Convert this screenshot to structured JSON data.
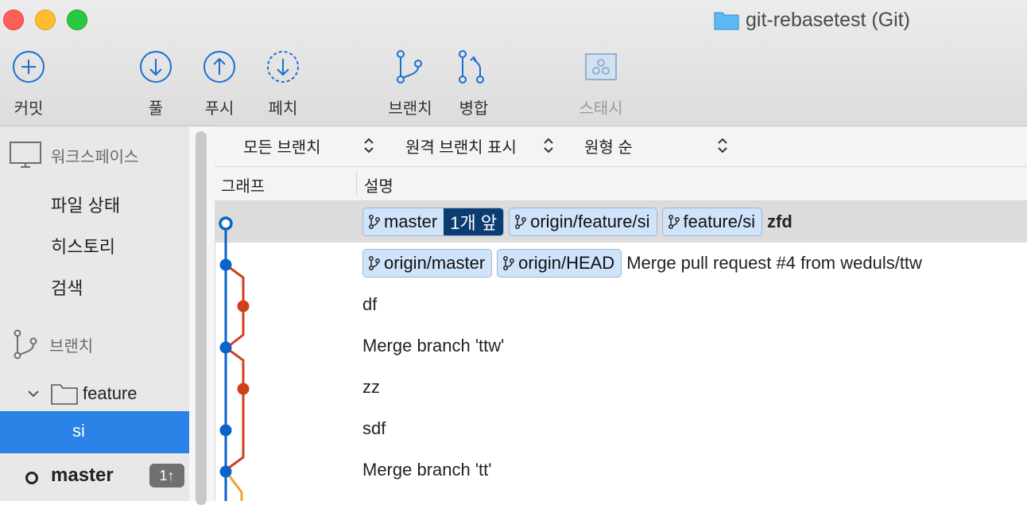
{
  "window": {
    "title": "git-rebasetest (Git)"
  },
  "toolbar": {
    "commit": "커밋",
    "pull": "풀",
    "push": "푸시",
    "fetch": "페치",
    "branch": "브랜치",
    "merge": "병합",
    "stash": "스태시"
  },
  "sidebar": {
    "workspace_header": "워크스페이스",
    "workspace_items": [
      "파일 상태",
      "히스토리",
      "검색"
    ],
    "branches_header": "브랜치",
    "folder": "feature",
    "selected_branch": "si",
    "master": "master",
    "master_badge": "1↑"
  },
  "filters": {
    "branches": "모든 브랜치",
    "remote": "원격 브랜치 표시",
    "order": "원형 순"
  },
  "columns": {
    "graph": "그래프",
    "description": "설명"
  },
  "commits": [
    {
      "tags": [
        "master",
        "origin/feature/si",
        "feature/si"
      ],
      "ahead": "1개 앞",
      "message": "zfd"
    },
    {
      "tags": [
        "origin/master",
        "origin/HEAD"
      ],
      "message": "Merge pull request #4 from weduls/ttw"
    },
    {
      "message": "df"
    },
    {
      "message": "Merge branch 'ttw'"
    },
    {
      "message": "zz"
    },
    {
      "message": "sdf"
    },
    {
      "message": "Merge branch 'tt'"
    }
  ],
  "colors": {
    "accent": "#2a82e6",
    "graph_main": "#0a63c7",
    "graph_branch": "#d0401c",
    "graph_other": "#f0a030",
    "tag_bg": "#cfe3fb",
    "ahead_bg": "#0b3d73"
  }
}
